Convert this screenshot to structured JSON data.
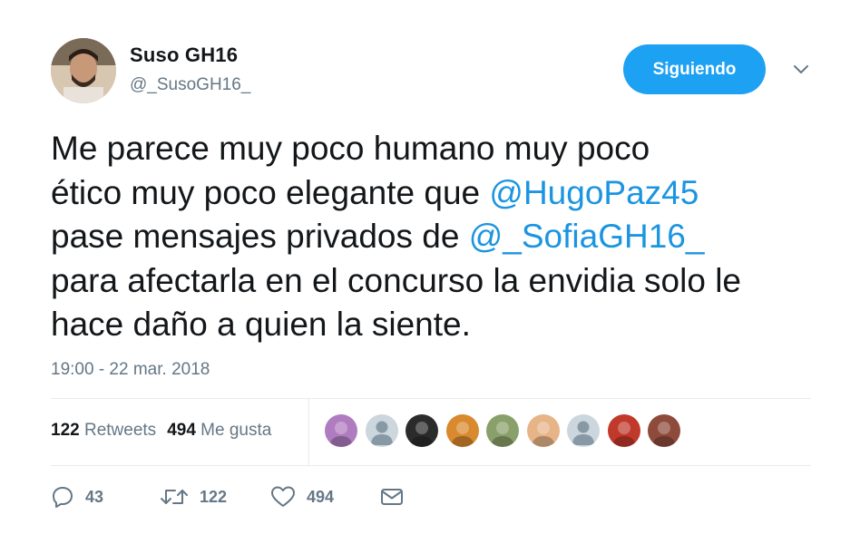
{
  "author": {
    "display_name": "Suso GH16",
    "handle": "@_SusoGH16_"
  },
  "follow_button": {
    "label": "Siguiendo"
  },
  "tweet": {
    "line1": "Me parece muy poco humano muy poco",
    "line2_pre": "ético muy poco elegante que ",
    "mention1": "@HugoPaz45",
    "line3_pre": "pase mensajes privados de ",
    "mention2": "@_SofiaGH16_",
    "line4": "para afectarla en el concurso la envidia solo le",
    "line5": "hace daño a quien la siente."
  },
  "timestamp": "19:00 - 22 mar. 2018",
  "stats": {
    "retweets_count": "122",
    "retweets_label": "Retweets",
    "likes_count": "494",
    "likes_label": "Me gusta"
  },
  "liked_by": [
    {
      "name": "liker-avatar-1",
      "color": "#b07cc0"
    },
    {
      "name": "liker-avatar-2-default",
      "color": "#ccd6dd"
    },
    {
      "name": "liker-avatar-3",
      "color": "#2b2b2b"
    },
    {
      "name": "liker-avatar-4",
      "color": "#d9892e"
    },
    {
      "name": "liker-avatar-5",
      "color": "#8aa06a"
    },
    {
      "name": "liker-avatar-6",
      "color": "#e7b488"
    },
    {
      "name": "liker-avatar-7-default",
      "color": "#ccd6dd"
    },
    {
      "name": "liker-avatar-8",
      "color": "#c0392b"
    },
    {
      "name": "liker-avatar-9",
      "color": "#8e4a3b"
    }
  ],
  "actions": {
    "reply_count": "43",
    "retweet_count": "122",
    "like_count": "494"
  },
  "colors": {
    "accent": "#1da1f2",
    "mention": "#1b95e0",
    "secondary_text": "#657786"
  }
}
